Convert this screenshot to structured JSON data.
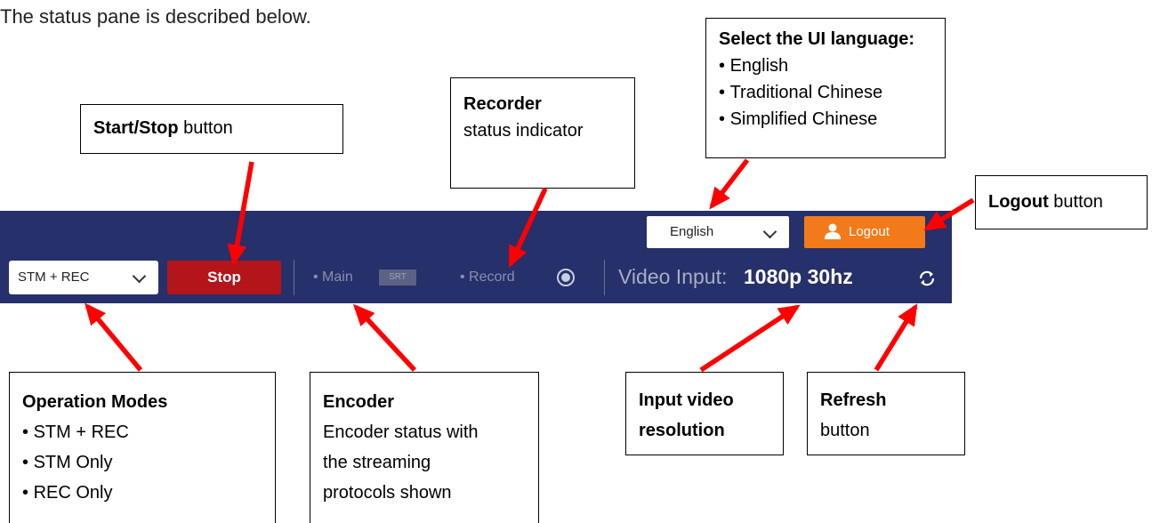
{
  "intro": "The status pane is described below.",
  "callouts": {
    "language": {
      "title": "Select the UI language:",
      "items": [
        "English",
        "Traditional Chinese",
        "Simplified Chinese"
      ]
    },
    "start_stop": {
      "bold": "Start/Stop",
      "rest": " button"
    },
    "recorder": {
      "bold": "Recorder",
      "line2": "status indicator"
    },
    "logout": {
      "bold": "Logout",
      "rest": " button"
    },
    "operation_modes": {
      "title": "Operation Modes",
      "items": [
        "STM + REC",
        "STM Only",
        "REC Only"
      ]
    },
    "encoder": {
      "title": "Encoder",
      "lines": [
        "Encoder status with",
        "the streaming",
        "protocols shown"
      ]
    },
    "input_video": {
      "lines": [
        "Input video",
        "resolution"
      ]
    },
    "refresh": {
      "bold": "Refresh",
      "line2": "button"
    }
  },
  "statusbar": {
    "language_value": "English",
    "logout_label": "Logout",
    "mode_value": "STM + REC",
    "stop_label": "Stop",
    "main_label": "• Main",
    "srt_badge": "SRT",
    "record_label": "• Record",
    "video_input_label": "Video Input:",
    "video_resolution": "1080p 30hz"
  },
  "colors": {
    "bar_background": "#26306a",
    "stop_button": "#b3151b",
    "logout_button": "#f27a1a",
    "arrow": "#ff0000"
  },
  "icons": [
    "chevron-down-icon",
    "person-icon",
    "record-icon",
    "refresh-icon"
  ]
}
